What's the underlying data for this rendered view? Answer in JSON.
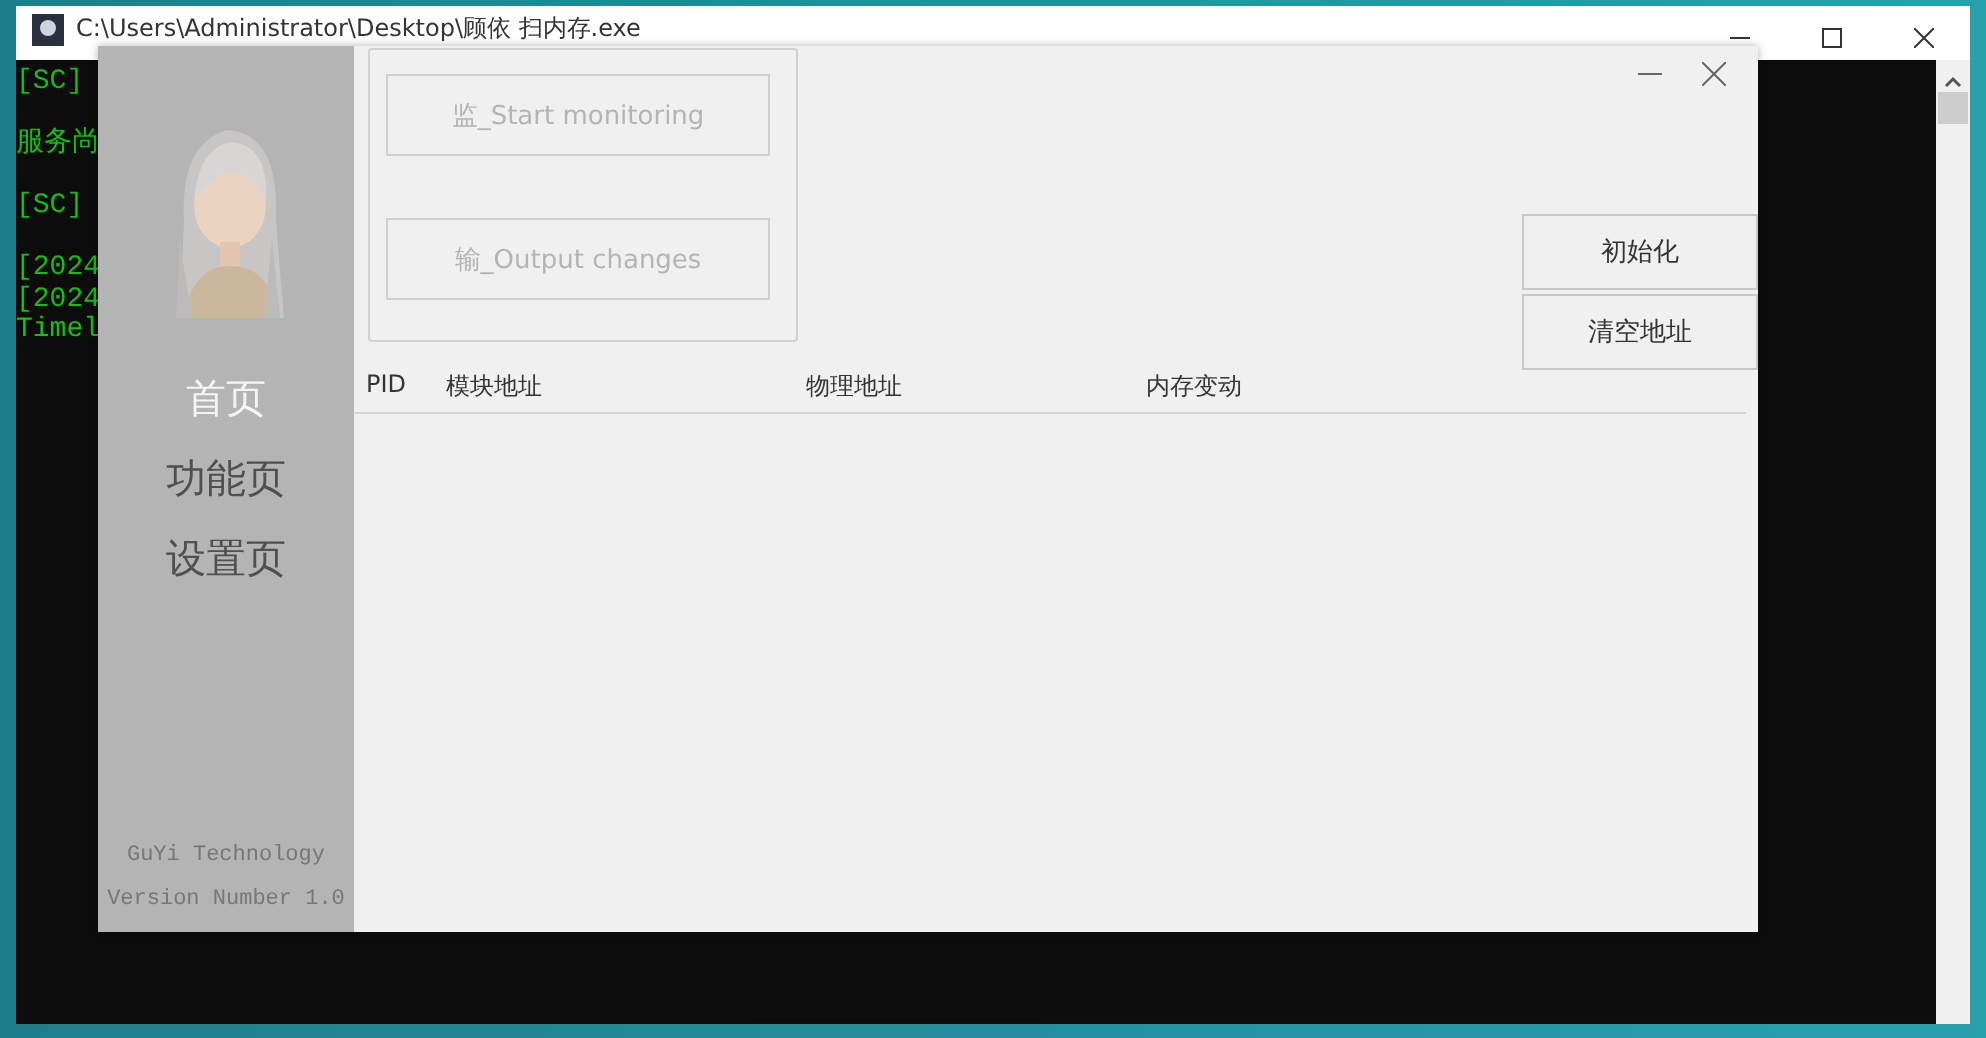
{
  "console": {
    "title": "C:\\Users\\Administrator\\Desktop\\顾依 扫内存.exe",
    "blocks": [
      [
        "[SC]"
      ],
      [
        "服务尚"
      ],
      [
        "[SC]"
      ],
      [
        "[2024",
        "[2024",
        "Timel"
      ]
    ]
  },
  "app": {
    "sidebar": {
      "avatar": {
        "kind": "picture"
      },
      "items": [
        {
          "label": "首页",
          "selected": true
        },
        {
          "label": "功能页",
          "selected": false
        },
        {
          "label": "设置页",
          "selected": false
        }
      ],
      "footer": [
        "GuYi Technology",
        "Version Number 1.0"
      ]
    },
    "group_buttons": [
      {
        "label": "监_Start monitoring",
        "disabled": true
      },
      {
        "label": "输_Output changes",
        "disabled": true
      }
    ],
    "side_buttons": [
      "初始化",
      "清空地址"
    ],
    "table": {
      "columns": [
        "PID",
        "模块地址",
        "物理地址",
        "内存变动"
      ]
    }
  }
}
